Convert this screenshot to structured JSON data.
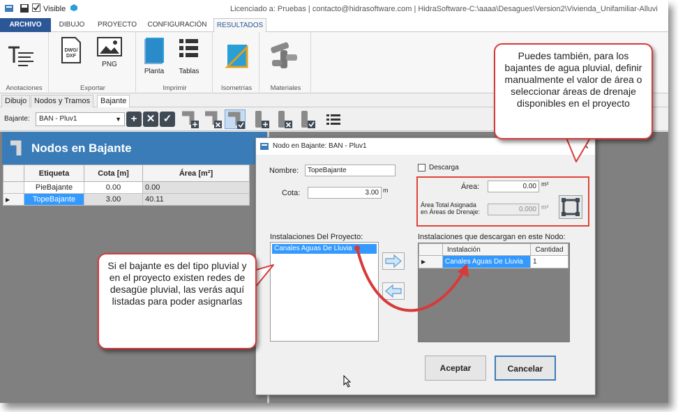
{
  "titlebar": {
    "visible_label": "Visible",
    "title": "Licenciado a: Pruebas | contacto@hidrasoftware.com | HidraSoftware-C:\\aaaa\\Desagues\\Version2\\Vivienda_Unifamiliar-Alluvi"
  },
  "ribbon_tabs": [
    "ARCHIVO",
    "DIBUJO",
    "PROYECTO",
    "CONFIGURACIÓN",
    "RESULTADOS"
  ],
  "ribbon": {
    "anotaciones": "Anotaciones",
    "exportar": "Exportar",
    "imprimir": "Imprimir",
    "isometrias": "Isometrías",
    "materiales": "Materiales",
    "dwg_label": "DWG/DXF",
    "png_label": "PNG",
    "planta_label": "Planta",
    "tablas_label": "Tablas"
  },
  "doc_tabs": [
    "Dibujo",
    "Nodos y Tramos",
    "Bajante"
  ],
  "toolbar": {
    "bajante_label": "Bajante:",
    "bajante_value": "BAN - Pluv1"
  },
  "nodos_panel": {
    "title": "Nodos en Bajante",
    "columns": [
      "Etiqueta",
      "Cota [m]",
      "Área [m²]"
    ],
    "rows": [
      {
        "etiqueta": "PieBajante",
        "cota": "0.00",
        "area": "0.00"
      },
      {
        "etiqueta": "TopeBajante",
        "cota": "3.00",
        "area": "40.11"
      }
    ]
  },
  "dialog": {
    "title": "Nodo en Bajante:  BAN - Pluv1",
    "nombre_label": "Nombre:",
    "nombre_value": "TopeBajante",
    "cota_label": "Cota:",
    "cota_value": "3.00",
    "cota_unit": "m",
    "descarga_label": "Descarga",
    "area_label": "Área:",
    "area_value": "0.00",
    "area_unit": "m²",
    "area_total_label_1": "Área Total Asignada",
    "area_total_label_2": "en Áreas de Drenaje:",
    "area_total_value": "0.000",
    "area_total_unit": "m²",
    "instalaciones_proyecto_label": "Instalaciones Del Proyecto:",
    "instalaciones_proyecto_items": [
      "Canales Aguas De Lluvia"
    ],
    "instalaciones_nodo_label": "Instalaciones que descargan en este Nodo:",
    "instalaciones_nodo_columns": [
      "Instalación",
      "Cantidad"
    ],
    "instalaciones_nodo_rows": [
      {
        "instalacion": "Canales Aguas De Lluvia",
        "cantidad": "1"
      }
    ],
    "aceptar": "Aceptar",
    "cancelar": "Cancelar"
  },
  "callouts": {
    "top": "Puedes también, para los bajantes de agua pluvial, definir manualmente el valor de área o seleccionar áreas de drenaje disponibles en el proyecto",
    "left": "Si el bajante es del tipo pluvial y en el proyecto existen redes de desagüe pluvial, las verás aquí listadas para poder asignarlas"
  },
  "colors": {
    "accent_blue": "#3a7cb8",
    "selection_blue": "#3399ff",
    "callout_red": "#d83a3a"
  }
}
